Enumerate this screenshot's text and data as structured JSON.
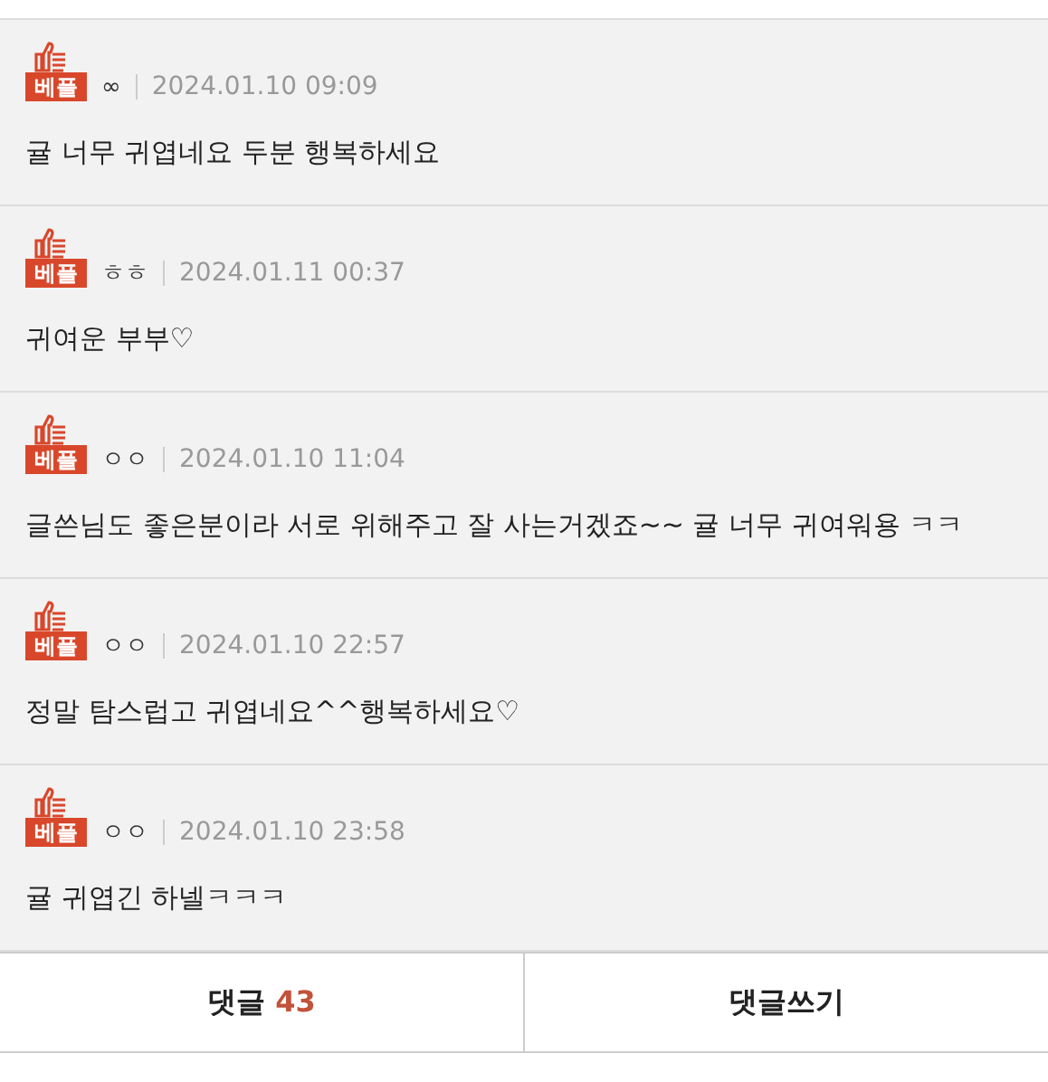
{
  "comments": [
    {
      "badge": "베플",
      "author": "∞",
      "date": "2024.01.10 09:09",
      "text": "귤 너무 귀엽네요 두분 행복하세요"
    },
    {
      "badge": "베플",
      "author": "ㅎㅎ",
      "date": "2024.01.11 00:37",
      "text": "귀여운 부부♡"
    },
    {
      "badge": "베플",
      "author": "ㅇㅇ",
      "date": "2024.01.10 11:04",
      "text": "글쓴님도 좋은분이라 서로 위해주고 잘 사는거겠죠~~ 귤 너무 귀여워용 ㅋㅋ"
    },
    {
      "badge": "베플",
      "author": "ㅇㅇ",
      "date": "2024.01.10 22:57",
      "text": "정말 탐스럽고 귀엽네요^^행복하세요♡"
    },
    {
      "badge": "베플",
      "author": "ㅇㅇ",
      "date": "2024.01.10 23:58",
      "text": "귤 귀엽긴 하넬ㅋㅋㅋ"
    }
  ],
  "footer": {
    "comments_label": "댓글",
    "comments_count": "43",
    "write_label": "댓글쓰기"
  }
}
